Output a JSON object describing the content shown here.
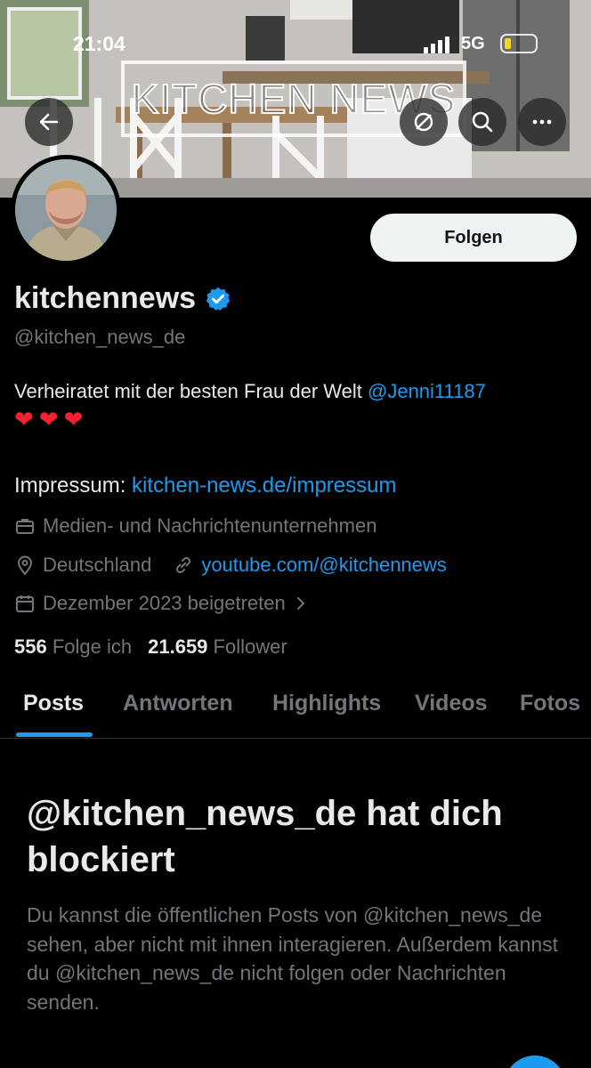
{
  "status_bar": {
    "time": "21:04",
    "network": "5G"
  },
  "banner": {
    "title": "KITCHEN NEWS"
  },
  "profile": {
    "display_name": "kitchennews",
    "handle": "@kitchen_news_de",
    "verified": true,
    "follow_label": "Folgen",
    "bio_text": "Verheiratet mit der besten Frau der Welt ",
    "bio_mention": "@Jenni11187",
    "hearts": "❤❤❤",
    "impressum_label": "Impressum: ",
    "impressum_link": "kitchen-news.de/impressum",
    "category": "Medien- und Nachrichtenunternehmen",
    "location": "Deutschland",
    "website": "youtube.com/@kitchennews",
    "joined": "Dezember 2023 beigetreten",
    "following_count": "556",
    "following_label": "Folge ich",
    "followers_count": "21.659",
    "followers_label": "Follower"
  },
  "tabs": [
    {
      "label": "Posts",
      "active": true
    },
    {
      "label": "Antworten",
      "active": false
    },
    {
      "label": "Highlights",
      "active": false
    },
    {
      "label": "Videos",
      "active": false
    },
    {
      "label": "Fotos",
      "active": false
    }
  ],
  "blocked": {
    "title": "@kitchen_news_de hat dich blockiert",
    "text": "Du kannst die öffentlichen Posts von @kitchen_news_de sehen, aber nicht mit ihnen interagieren. Außerdem kannst du @kitchen_news_de nicht folgen oder Nachrichten senden."
  },
  "colors": {
    "accent": "#1d9bf0",
    "background": "#000000",
    "muted": "#71767b",
    "text": "#e7e9ea"
  },
  "icons": [
    "back-arrow-icon",
    "translate-off-icon",
    "search-icon",
    "more-icon",
    "verified-badge-icon",
    "briefcase-icon",
    "location-pin-icon",
    "link-icon",
    "calendar-icon",
    "chevron-right-icon"
  ]
}
